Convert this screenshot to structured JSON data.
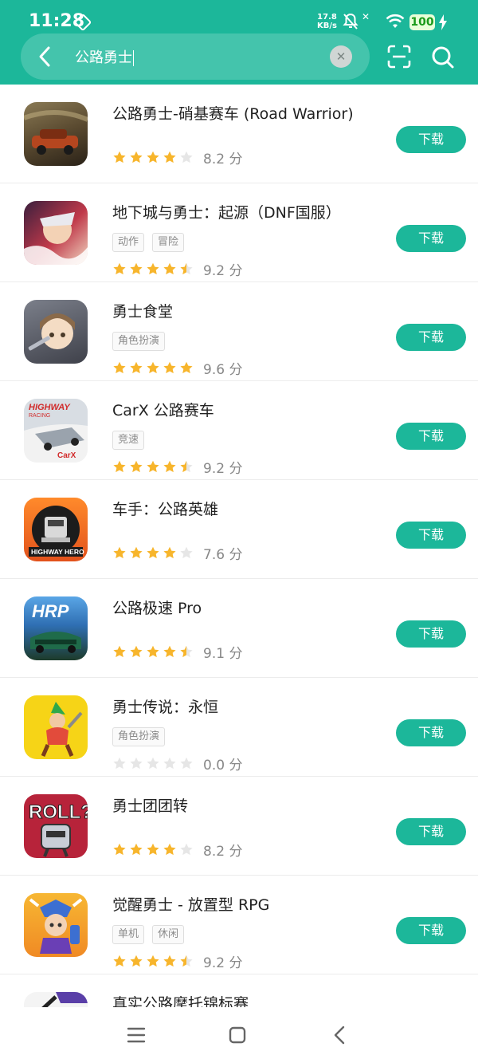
{
  "status_bar": {
    "time": "11:28",
    "speed_value": "17.8",
    "speed_unit": "KB/s",
    "battery": "100"
  },
  "search": {
    "query": "公路勇士"
  },
  "download_label": "下载",
  "apps": [
    {
      "name": "公路勇士-硝基赛车 (Road Warrior)",
      "tags": [],
      "rating": 4,
      "score": "8.2 分",
      "icon": "road-warrior-icon"
    },
    {
      "name": "地下城与勇士：起源（DNF国服）",
      "tags": [
        "动作",
        "冒险"
      ],
      "rating": 4.5,
      "score": "9.2 分",
      "icon": "dnf-origin-icon"
    },
    {
      "name": "勇士食堂",
      "tags": [
        "角色扮演"
      ],
      "rating": 5,
      "score": "9.6 分",
      "icon": "warrior-canteen-icon"
    },
    {
      "name": "CarX 公路赛车",
      "tags": [
        "竞速"
      ],
      "rating": 4.5,
      "score": "9.2 分",
      "icon": "carx-highway-racing-icon"
    },
    {
      "name": "车手：公路英雄",
      "tags": [],
      "rating": 4,
      "score": "7.6 分",
      "icon": "highway-hero-icon"
    },
    {
      "name": "公路极速 Pro",
      "tags": [],
      "rating": 4.5,
      "score": "9.1 分",
      "icon": "hrp-icon"
    },
    {
      "name": "勇士传说：永恒",
      "tags": [
        "角色扮演"
      ],
      "rating": 0,
      "score": "0.0 分",
      "icon": "warrior-legend-icon"
    },
    {
      "name": "勇士团团转",
      "tags": [],
      "rating": 4,
      "score": "8.2 分",
      "icon": "roll-icon"
    },
    {
      "name": "觉醒勇士 - 放置型 RPG",
      "tags": [
        "单机",
        "休闲"
      ],
      "rating": 4.5,
      "score": "9.2 分",
      "icon": "awakened-warrior-icon"
    },
    {
      "name": "真实公路摩托锦标赛",
      "tags": [],
      "rating": null,
      "score": "",
      "icon": "moto-championship-icon"
    }
  ],
  "colors": {
    "accent": "#1cb79a",
    "star_filled": "#f7b52c",
    "star_empty": "#e6e6e6"
  }
}
